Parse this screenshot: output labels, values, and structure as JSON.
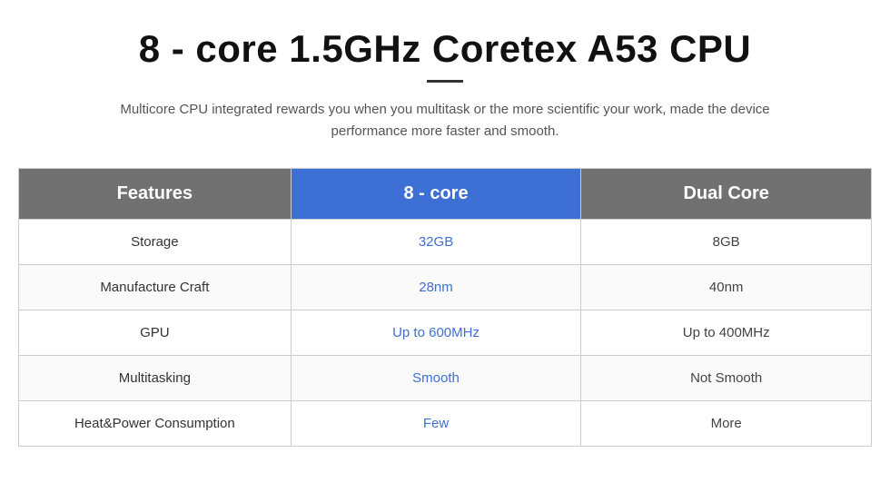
{
  "header": {
    "title": "8 - core 1.5GHz Coretex A53 CPU",
    "subtitle": "Multicore CPU integrated rewards you when you multitask or the more scientific your work, made the device performance more faster and smooth."
  },
  "table": {
    "columns": {
      "features_label": "Features",
      "eightcore_label": "8 - core",
      "dualcore_label": "Dual Core"
    },
    "rows": [
      {
        "feature": "Storage",
        "eightcore": "32GB",
        "dualcore": "8GB"
      },
      {
        "feature": "Manufacture Craft",
        "eightcore": "28nm",
        "dualcore": "40nm"
      },
      {
        "feature": "GPU",
        "eightcore": "Up to 600MHz",
        "dualcore": "Up to 400MHz"
      },
      {
        "feature": "Multitasking",
        "eightcore": "Smooth",
        "dualcore": "Not Smooth"
      },
      {
        "feature": "Heat&Power Consumption",
        "eightcore": "Few",
        "dualcore": "More"
      }
    ]
  }
}
